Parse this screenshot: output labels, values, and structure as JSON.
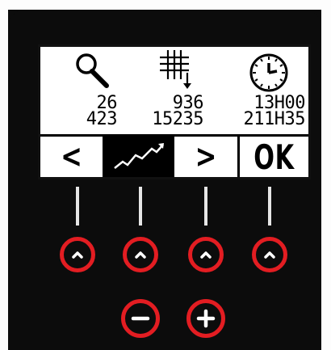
{
  "screen": {
    "columns": [
      {
        "icon": "magnifier-icon",
        "line1": "26",
        "line2": "423"
      },
      {
        "icon": "grid-down-arrow-icon",
        "line1": "936",
        "line2": "15235"
      },
      {
        "icon": "clock-icon",
        "line1": "13H00",
        "line2": "211H35"
      }
    ],
    "softkeys": [
      {
        "label": "<",
        "icon": "chevron-left-icon",
        "selected": false
      },
      {
        "label": "",
        "icon": "trend-graph-icon",
        "selected": true
      },
      {
        "label": ">",
        "icon": "chevron-right-icon",
        "selected": false
      },
      {
        "label": "OK",
        "icon": "",
        "selected": false
      }
    ]
  },
  "buttons": {
    "up": [
      "chevron-up-icon",
      "chevron-up-icon",
      "chevron-up-icon",
      "chevron-up-icon"
    ],
    "minus": "minus-icon",
    "plus": "plus-icon"
  },
  "colors": {
    "panel": "#0c0c0c",
    "button_ring": "#e31d22",
    "lcd_background": "#ffffff",
    "lcd_ink": "#000000"
  }
}
